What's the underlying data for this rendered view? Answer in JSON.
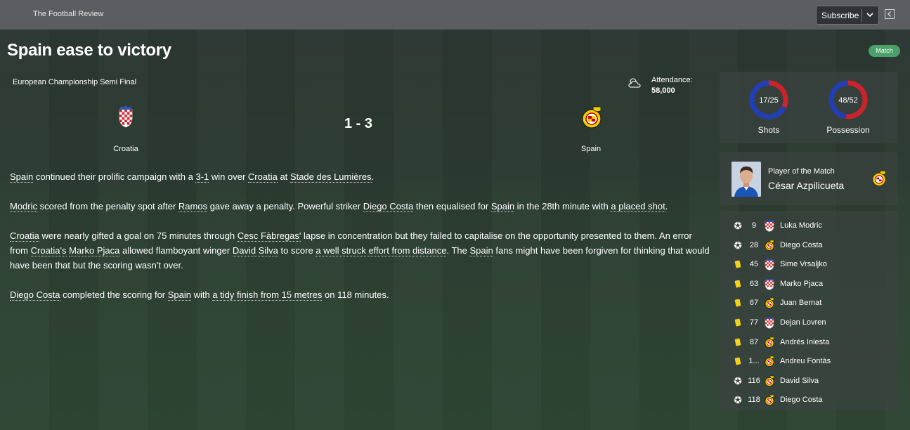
{
  "header": {
    "site_name": "The Football Review",
    "subscribe_label": "Subscribe"
  },
  "headline": "Spain ease to victory",
  "badge": "Match",
  "match": {
    "competition": "European Championship Semi Final",
    "attendance_label": "Attendance:",
    "attendance_value": "58,000",
    "score": "1 - 3",
    "home_team": "Croatia",
    "away_team": "Spain"
  },
  "article": {
    "p1": [
      "Spain",
      " continued their prolific campaign with a ",
      "3-1",
      " win over ",
      "Croatia",
      " at ",
      "Stade des Lumières",
      "."
    ],
    "p2": [
      "Modric",
      " scored from the penalty spot after ",
      "Ramos",
      " gave away a penalty. Powerful striker ",
      "Diego Costa",
      " then equalised for ",
      "Spain",
      " in the 28th minute with ",
      "a placed shot",
      "."
    ],
    "p3": [
      "Croatia",
      " were nearly gifted a goal on 75 minutes through ",
      "Cesc Fàbregas'",
      " lapse in concentration but they failed to capitalise on the opportunity presented to them. An error from ",
      "Croatia's",
      " ",
      "Marko Pjaca",
      " allowed flamboyant winger ",
      "David Silva",
      " to score ",
      "a well struck effort from distance",
      ". The ",
      "Spain",
      " fans might have been forgiven for thinking that would have been that but the scoring wasn't over."
    ],
    "p4": [
      "Diego Costa",
      " completed the scoring for ",
      "Spain",
      " with ",
      "a tidy finish from 15 metres",
      " on 118 minutes."
    ]
  },
  "stats": {
    "shots": {
      "label": "Shots",
      "text": "17/25",
      "home": 17,
      "total": 25
    },
    "possession": {
      "label": "Possession",
      "text": "48/52",
      "home": 48,
      "total": 100
    },
    "home_color": "#c9232b",
    "away_color": "#1f3fb8"
  },
  "potm": {
    "label": "Player of the Match",
    "name": "César Azpilicueta"
  },
  "events": [
    {
      "type": "goal-icon",
      "minute": "9",
      "team": "croatia",
      "player": "Luka Modric"
    },
    {
      "type": "goal-icon",
      "minute": "28",
      "team": "spain",
      "player": "Diego Costa"
    },
    {
      "type": "yellow-card-icon",
      "minute": "45",
      "team": "croatia",
      "player": "Sime Vrsaljko"
    },
    {
      "type": "yellow-card-icon",
      "minute": "63",
      "team": "croatia",
      "player": "Marko Pjaca"
    },
    {
      "type": "yellow-card-icon",
      "minute": "67",
      "team": "spain",
      "player": "Juan Bernat"
    },
    {
      "type": "yellow-card-icon",
      "minute": "77",
      "team": "croatia",
      "player": "Dejan Lovren"
    },
    {
      "type": "yellow-card-icon",
      "minute": "87",
      "team": "spain",
      "player": "Andrés Iniesta"
    },
    {
      "type": "yellow-card-icon",
      "minute": "1...",
      "team": "spain",
      "player": "Andreu Fontàs"
    },
    {
      "type": "goal-icon",
      "minute": "116",
      "team": "spain",
      "player": "David Silva"
    },
    {
      "type": "goal-icon",
      "minute": "118",
      "team": "spain",
      "player": "Diego Costa"
    }
  ]
}
